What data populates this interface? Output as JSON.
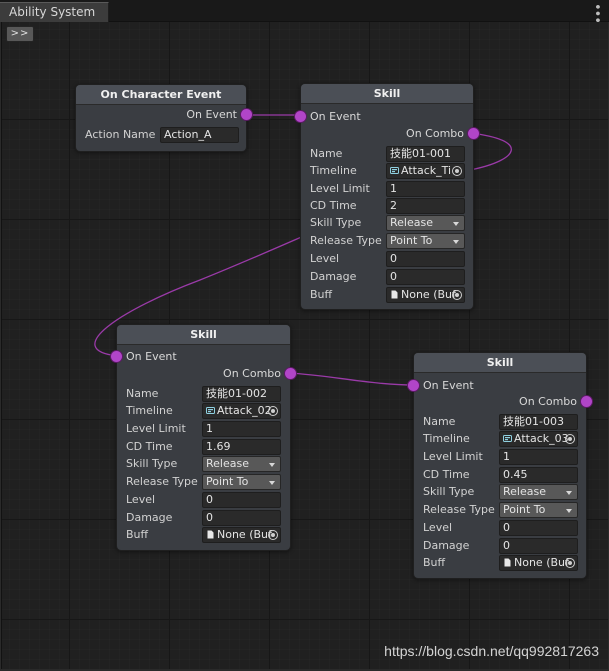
{
  "window": {
    "tab_title": "Ability System",
    "expand_button": ">>"
  },
  "colors": {
    "port": "#b145c8",
    "wire": "#9a3aa8"
  },
  "event_node": {
    "title": "On Character Event",
    "output_port": "On Event",
    "field_label": "Action Name",
    "field_value": "Action_A"
  },
  "skill_nodes": [
    {
      "title": "Skill",
      "input_port": "On Event",
      "output_port": "On Combo",
      "labels": {
        "name": "Name",
        "timeline": "Timeline",
        "level_limit": "Level Limit",
        "cd_time": "CD Time",
        "skill_type": "Skill Type",
        "release_type": "Release Type",
        "level": "Level",
        "damage": "Damage",
        "buff": "Buff"
      },
      "values": {
        "name": "技能01-001",
        "timeline": "Attack_Ti",
        "level_limit": "1",
        "cd_time": "2",
        "skill_type": "Release",
        "release_type": "Point To",
        "level": "0",
        "damage": "0",
        "buff": "None (Buf"
      }
    },
    {
      "title": "Skill",
      "input_port": "On Event",
      "output_port": "On Combo",
      "labels": {
        "name": "Name",
        "timeline": "Timeline",
        "level_limit": "Level Limit",
        "cd_time": "CD Time",
        "skill_type": "Skill Type",
        "release_type": "Release Type",
        "level": "Level",
        "damage": "Damage",
        "buff": "Buff"
      },
      "values": {
        "name": "技能01-002",
        "timeline": "Attack_02",
        "level_limit": "1",
        "cd_time": "1.69",
        "skill_type": "Release",
        "release_type": "Point To",
        "level": "0",
        "damage": "0",
        "buff": "None (Buf"
      }
    },
    {
      "title": "Skill",
      "input_port": "On Event",
      "output_port": "On Combo",
      "labels": {
        "name": "Name",
        "timeline": "Timeline",
        "level_limit": "Level Limit",
        "cd_time": "CD Time",
        "skill_type": "Skill Type",
        "release_type": "Release Type",
        "level": "Level",
        "damage": "Damage",
        "buff": "Buff"
      },
      "values": {
        "name": "技能01-003",
        "timeline": "Attack_03",
        "level_limit": "1",
        "cd_time": "0.45",
        "skill_type": "Release",
        "release_type": "Point To",
        "level": "0",
        "damage": "0",
        "buff": "None (Buf"
      }
    }
  ],
  "watermark": "https://blog.csdn.net/qq992817263"
}
